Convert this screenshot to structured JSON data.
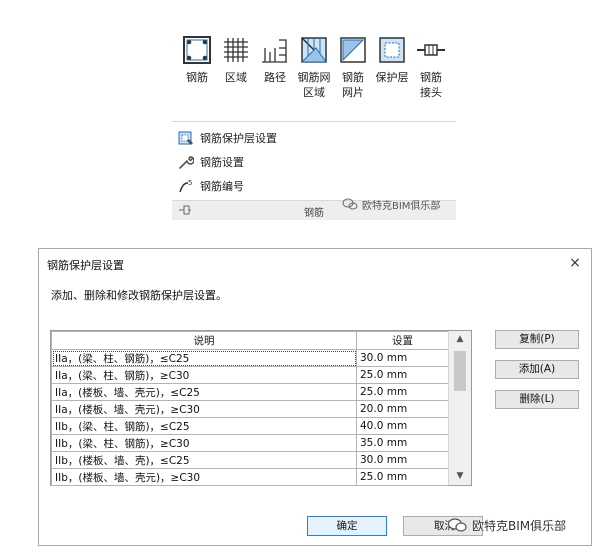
{
  "ribbon": {
    "buttons": [
      {
        "label": "钢筋",
        "icon": "rebar-icon"
      },
      {
        "label": "区域",
        "icon": "area-rebar-icon"
      },
      {
        "label": "路径",
        "icon": "path-rebar-icon"
      },
      {
        "label": "钢筋网\n区域",
        "icon": "fabric-area-icon"
      },
      {
        "label": "钢筋\n网片",
        "icon": "fabric-sheet-icon"
      },
      {
        "label": "保护层",
        "icon": "cover-icon"
      },
      {
        "label": "钢筋\n接头",
        "icon": "coupler-icon"
      }
    ],
    "rows": [
      {
        "label": "钢筋保护层设置",
        "icon": "cover-settings-icon"
      },
      {
        "label": "钢筋设置",
        "icon": "wrench-icon"
      },
      {
        "label": "钢筋编号",
        "icon": "rebar-number-icon"
      }
    ],
    "footer_title": "钢筋",
    "watermark": "欧特克BIM俱乐部"
  },
  "dialog": {
    "title": "钢筋保护层设置",
    "close": "×",
    "description": "添加、删除和修改钢筋保护层设置。",
    "columns": [
      "说明",
      "设置"
    ],
    "rows": [
      [
        "IIa，(梁、柱、钢筋)，≤C25",
        "30.0 mm"
      ],
      [
        "IIa，(梁、柱、钢筋)，≥C30",
        "25.0 mm"
      ],
      [
        "IIa，(楼板、墙、壳元)，≤C25",
        "25.0 mm"
      ],
      [
        "IIa，(楼板、墙、壳元)，≥C30",
        "20.0 mm"
      ],
      [
        "IIb，(梁、柱、钢筋)，≤C25",
        "40.0 mm"
      ],
      [
        "IIb，(梁、柱、钢筋)，≥C30",
        "35.0 mm"
      ],
      [
        "IIb，(楼板、墙、壳)，≤C25",
        "30.0 mm"
      ],
      [
        "IIb，(楼板、墙、壳元)，≥C30",
        "25.0 mm"
      ]
    ],
    "buttons": {
      "copy": "复制(P)",
      "add": "添加(A)",
      "delete": "删除(L)",
      "ok": "确定",
      "cancel": "取消"
    },
    "watermark": "欧特克BIM俱乐部"
  },
  "colors": {
    "accent": "#2d7cd6",
    "icon_blue": "#1f6fb5",
    "icon_fill": "#cfe3f5"
  }
}
